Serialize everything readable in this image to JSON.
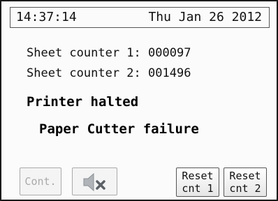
{
  "header": {
    "time": "14:37:14",
    "date": "Thu Jan 26 2012"
  },
  "counters": [
    {
      "label": "Sheet counter 1:",
      "value": "000097"
    },
    {
      "label": "Sheet counter 2:",
      "value": "001496"
    }
  ],
  "status": {
    "state": "Printer halted",
    "error": "Paper Cutter failure"
  },
  "buttons": {
    "cont": "Cont.",
    "mute_icon": "speaker-mute-icon",
    "reset1_line1": "Reset",
    "reset1_line2": "cnt 1",
    "reset2_line1": "Reset",
    "reset2_line2": "cnt 2"
  }
}
